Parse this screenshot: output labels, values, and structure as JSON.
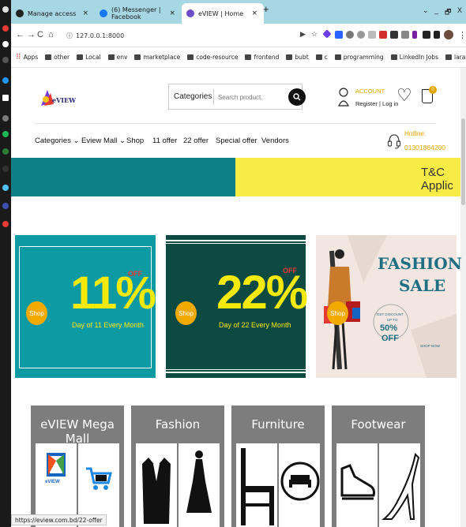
{
  "browser": {
    "tabs": [
      {
        "label": "Manage access"
      },
      {
        "label": "(6) Messenger | Facebook"
      },
      {
        "label": "eVIEW | Home"
      }
    ],
    "url": "127.0.0.1:8000",
    "window_controls": {
      "min": "⌄",
      "dash": "_",
      "restore": "🗗",
      "close": "X"
    },
    "bookmarks": [
      "Apps",
      "other",
      "Local",
      "env",
      "marketplace",
      "code-resource",
      "frontend",
      "bubt",
      "c",
      "programming",
      "LinkedIn Jobs",
      "laravel"
    ],
    "status_url": "https://eview.com.bd/22-offer"
  },
  "header": {
    "logo_text": "eVIEW",
    "categories_button": "Categories",
    "search_placeholder": "Search product.",
    "account_label": "ACCOUNT",
    "account_sub": "Register | Log in",
    "cart_count": "0",
    "hotline_label": "Hotline:",
    "hotline_number": "01301864200"
  },
  "menu": {
    "categories": "Categories ⌄",
    "eview_mall": "Eview Mall ⌄",
    "shop": "Shop",
    "offer_11": "11 offer",
    "offer_22": "22 offer",
    "special_offer": "Special offer",
    "vendors": "Vendors"
  },
  "banner": {
    "text": "T&C Applic"
  },
  "promos": {
    "p11": {
      "shop": "Shop",
      "pct": "11%",
      "off": "OFF",
      "sub": "Day of 11 Every Month"
    },
    "p22": {
      "shop": "Shop",
      "pct": "22%",
      "off": "OFF",
      "sub": "Day of 22 Every Month"
    },
    "fashion": {
      "shop": "Shop",
      "title1": "FASHION",
      "title2": "SALE",
      "badge1": "GET DISCOUNT",
      "badge2": "UP TO",
      "badge3": "50%",
      "badge4": "OFF",
      "cta": "SHOP NOW"
    }
  },
  "categories": [
    {
      "title": "eVIEW Mega Mall"
    },
    {
      "title": "Fashion"
    },
    {
      "title": "Furniture"
    },
    {
      "title": "Footwear"
    }
  ],
  "mall_logo_text": "eVIEW",
  "colors": {
    "teal": "#0e9aa3",
    "dark_green": "#0c4a42",
    "yellow": "#f4ea0a",
    "shop_orange": "#f2a900",
    "gold": "#e3a400",
    "card_gray": "#7d7d7d"
  }
}
